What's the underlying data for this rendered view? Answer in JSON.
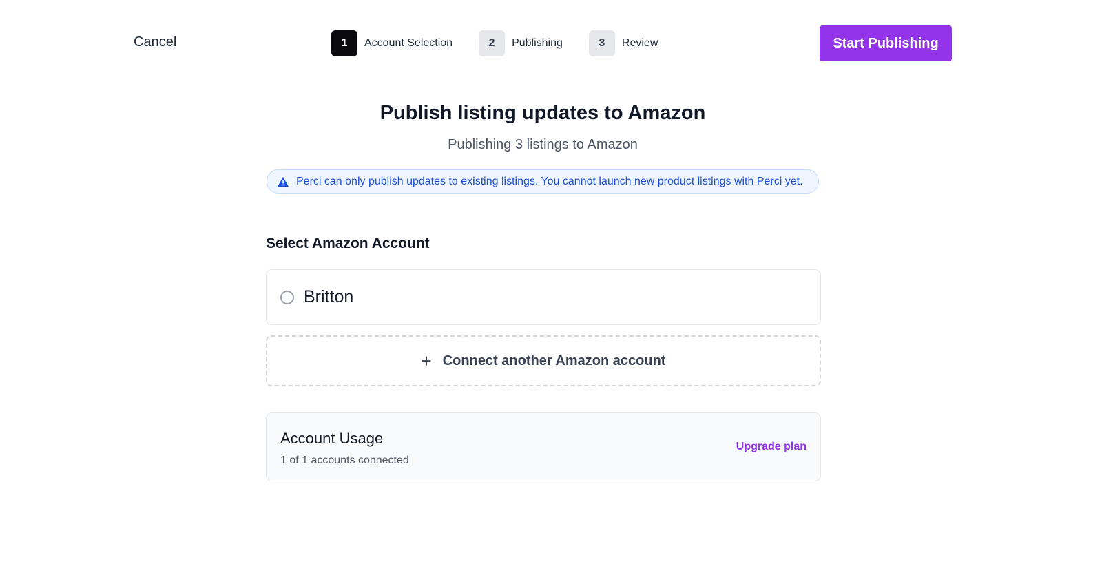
{
  "header": {
    "cancel_label": "Cancel",
    "steps": [
      {
        "number": "1",
        "label": "Account Selection",
        "active": true
      },
      {
        "number": "2",
        "label": "Publishing",
        "active": false
      },
      {
        "number": "3",
        "label": "Review",
        "active": false
      }
    ],
    "start_label": "Start Publishing"
  },
  "main": {
    "title": "Publish listing updates to Amazon",
    "subtitle": "Publishing 3 listings to Amazon",
    "notice": "Perci can only publish updates to existing listings. You cannot launch new product listings with Perci yet.",
    "section_title": "Select Amazon Account",
    "accounts": [
      {
        "name": "Britton",
        "selected": false
      }
    ],
    "connect_label": "Connect another Amazon account",
    "usage": {
      "title": "Account Usage",
      "summary": "1 of 1 accounts connected",
      "upgrade_label": "Upgrade plan"
    }
  },
  "colors": {
    "accent": "#9333ea",
    "notice_text": "#1d4ed8",
    "notice_bg": "#eff6ff",
    "active_step": "#0b0b0f"
  },
  "icons": [
    "warning-icon",
    "plus-icon",
    "radio-unchecked"
  ]
}
